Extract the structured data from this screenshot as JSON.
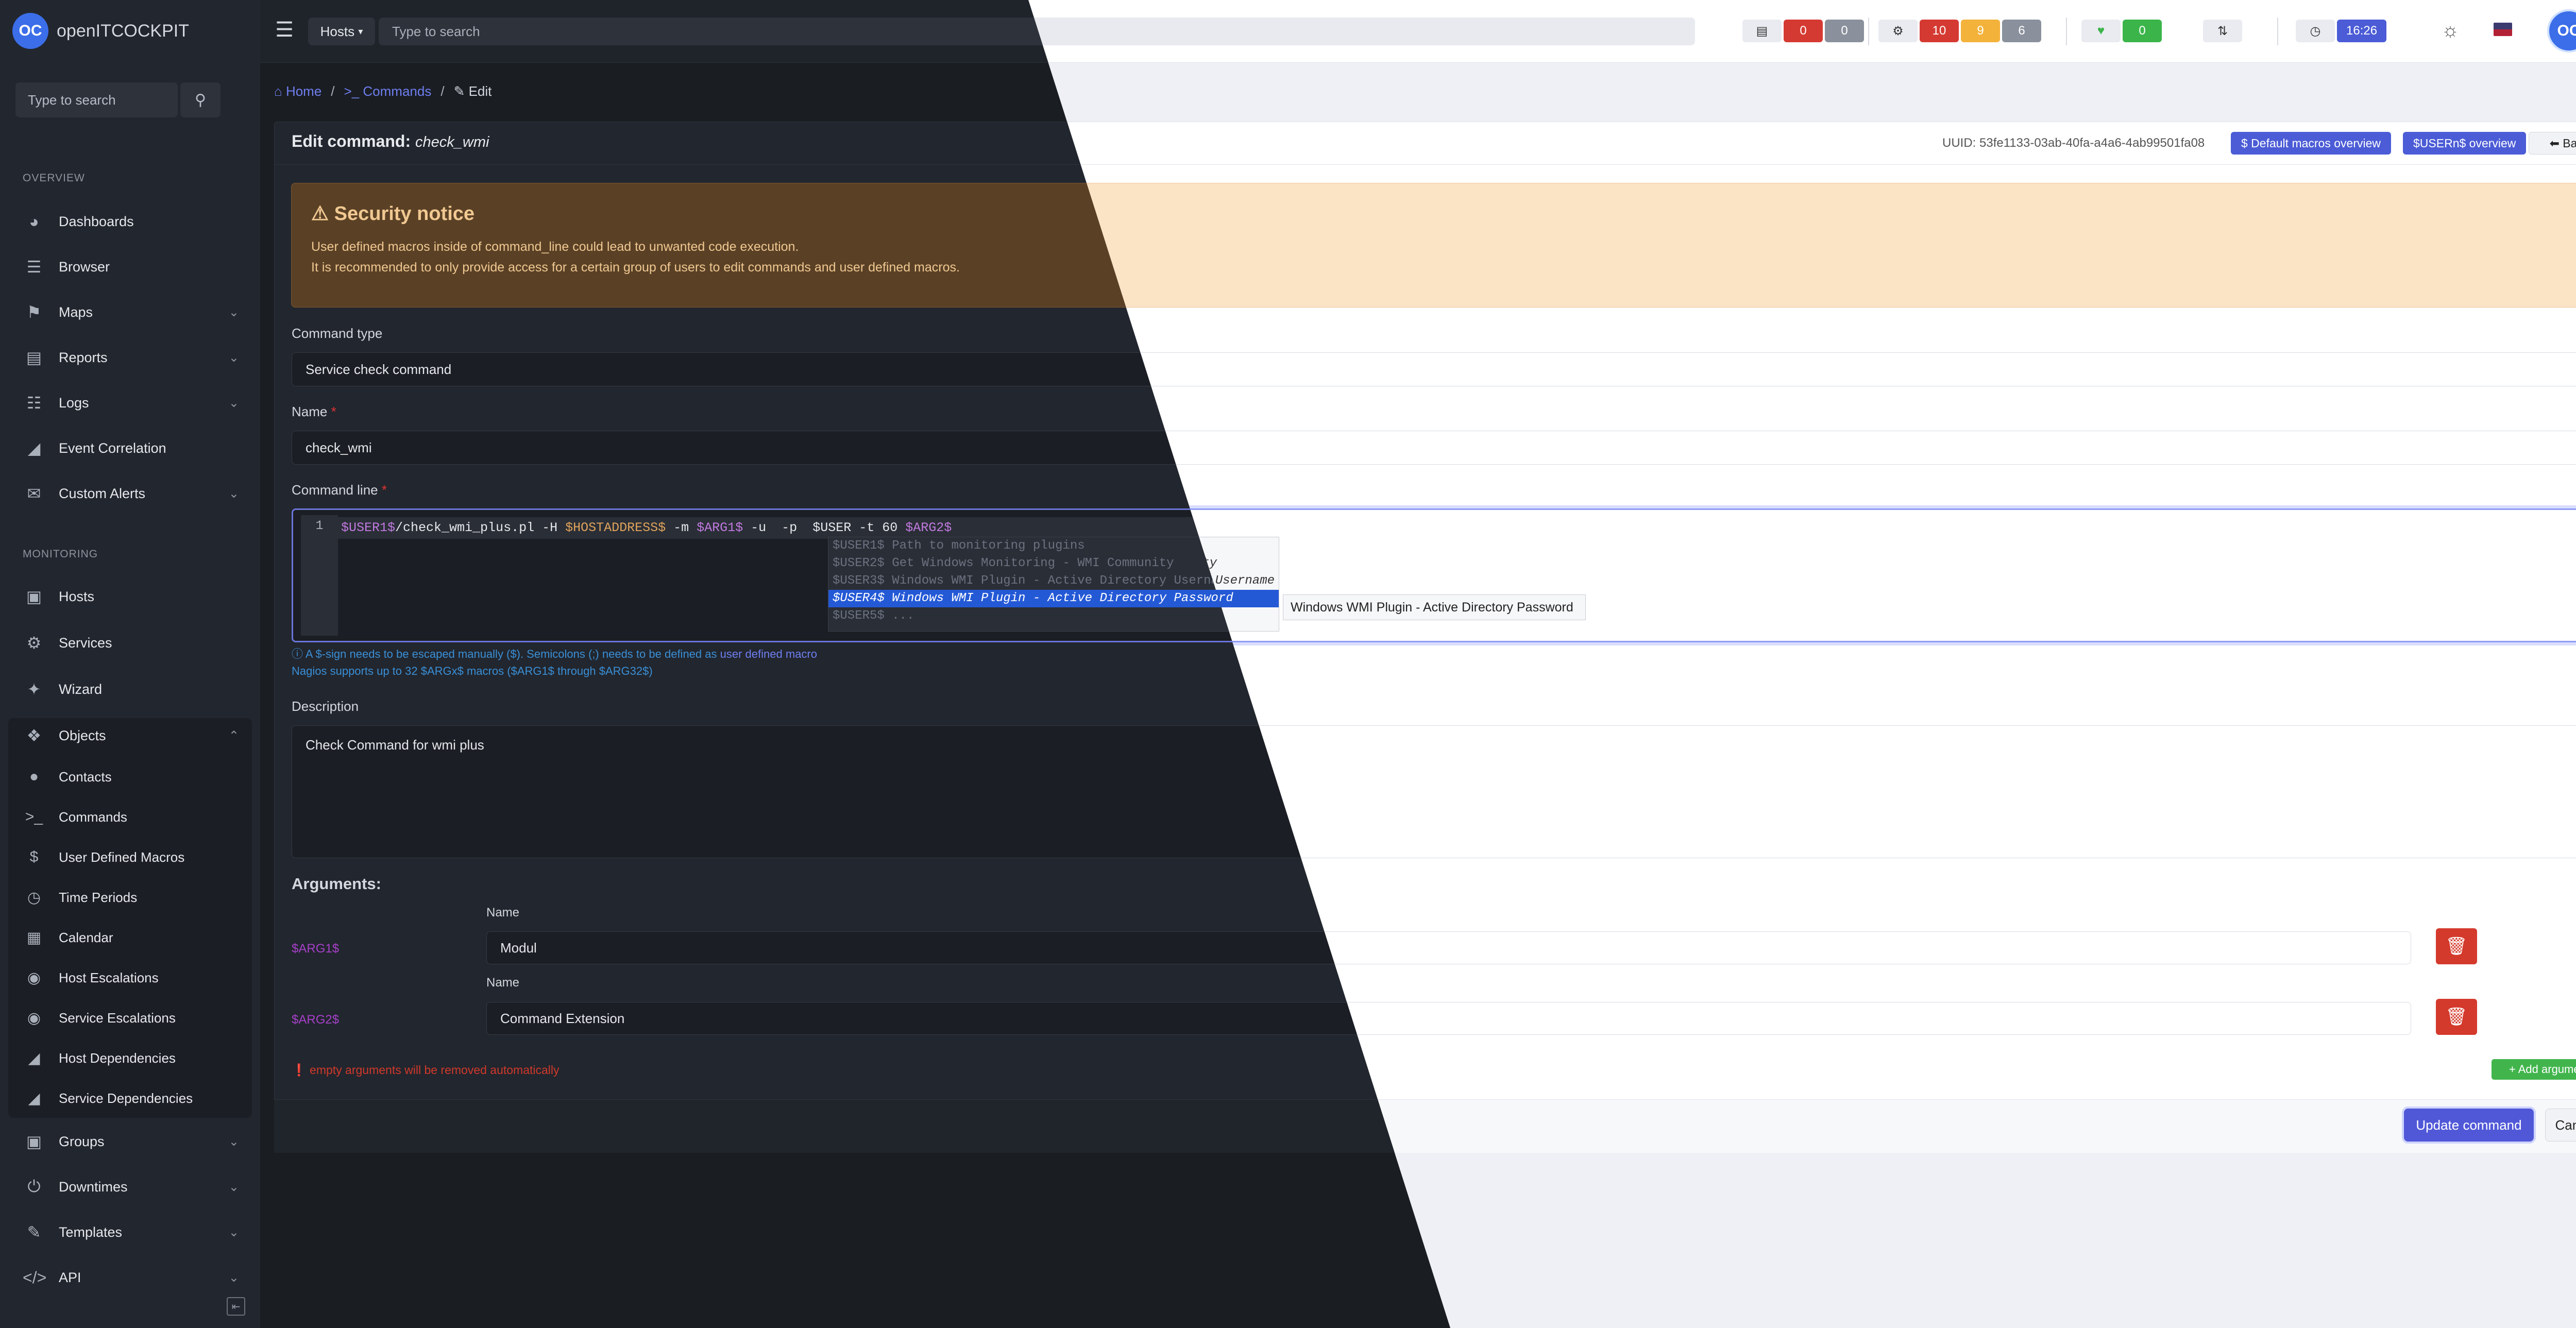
{
  "app": {
    "name": "openITCOCKPIT",
    "logo_initials": "OC"
  },
  "topbar": {
    "scope": "Hosts",
    "search_placeholder": "Type to search",
    "host_counts": [
      "0",
      "0"
    ],
    "service_counts": [
      "10",
      "9",
      "6"
    ],
    "ok_count": "0",
    "clock": "16:26",
    "avatar_initials": "OC"
  },
  "sidebar": {
    "search_placeholder": "Type to search",
    "overview_heading": "OVERVIEW",
    "monitoring_heading": "MONITORING",
    "overview": [
      "Dashboards",
      "Browser",
      "Maps",
      "Reports",
      "Logs",
      "Event Correlation",
      "Custom Alerts"
    ],
    "monitoring": [
      "Hosts",
      "Services",
      "Wizard",
      "Objects"
    ],
    "objects_sub": [
      "Contacts",
      "Commands",
      "User Defined Macros",
      "Time Periods",
      "Calendar",
      "Host Escalations",
      "Service Escalations",
      "Host Dependencies",
      "Service Dependencies"
    ],
    "tail": [
      "Groups",
      "Downtimes",
      "Templates",
      "API"
    ]
  },
  "breadcrumb": {
    "home": "Home",
    "commands": "Commands",
    "edit": "Edit",
    "sep": "/"
  },
  "header": {
    "title": "Edit command:",
    "command_name": "check_wmi",
    "uuid": "UUID: 53fe1133-03ab-40fa-a4a6-4ab99501fa08",
    "default_macros_btn": "$ Default macros overview",
    "usern_btn": "$USERn$ overview",
    "back_btn": "Back"
  },
  "notice": {
    "title": "Security notice",
    "line1": "User defined macros inside of command_line could lead to unwanted code execution.",
    "line2": "It is recommended to only provide access for a certain group of users to edit commands and user defined macros."
  },
  "form": {
    "command_type_label": "Command type",
    "command_type_value": "Service check command",
    "name_label": "Name",
    "name_value": "check_wmi",
    "command_line_label": "Command line",
    "line_number": "1",
    "code": {
      "user1": "$USER1$",
      "path": "/check_wmi_plus.pl -H ",
      "hostaddr": "$HOSTADDRESS$",
      "m": " -m ",
      "arg1": "$ARG1$",
      "up": " -u  -p  $USER -t 60 ",
      "arg2": "$ARG2$"
    },
    "autocomplete": {
      "row1": "$USER1$ Path to monitoring plugins",
      "row2": "$USER2$ Get Windows Monitoring - WMI Community",
      "row3": "$USER3$ Windows WMI Plugin - Active Directory Username",
      "row4": "$USER4$ Windows WMI Plugin - Active Directory Password",
      "row5": "$USER5$ ...",
      "light_fragment_1": "ty",
      "light_fragment_2": "Username",
      "tooltip": "Windows WMI Plugin - Active Directory Password"
    },
    "help_line1": "A $-sign needs to be escaped manually ($). Semicolons (;) needs to be defined as",
    "help_link": "user defined macro",
    "help_line2": "Nagios supports up to 32 $ARGx$ macros ($ARG1$ through $ARG32$)",
    "description_label": "Description",
    "description_value": "Check Command for wmi plus",
    "arguments_title": "Arguments:",
    "arguments": [
      {
        "macro": "$ARG1$",
        "name_label": "Name",
        "value": "Modul"
      },
      {
        "macro": "$ARG2$",
        "name_label": "Name",
        "value": "Command Extension"
      }
    ],
    "empty_warning": "empty arguments will be removed automatically",
    "add_argument": "+ Add argument"
  },
  "footer": {
    "update": "Update command",
    "cancel": "Cancel"
  },
  "colors": {
    "accent": "#4b5cd6",
    "danger": "#d43a2c",
    "success": "#41b54c",
    "macro": "#a640c9"
  }
}
